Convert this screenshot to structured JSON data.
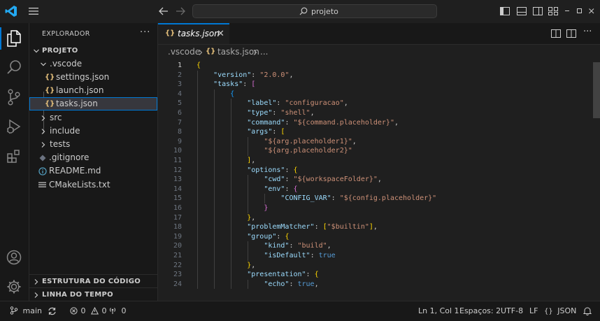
{
  "titlebar": {
    "search_text": "projeto"
  },
  "sidebar": {
    "title": "EXPLORADOR",
    "more": "···",
    "root": "PROJETO",
    "tree": [
      {
        "label": ".vscode",
        "type": "folder",
        "open": true,
        "depth": 1
      },
      {
        "label": "settings.json",
        "type": "json",
        "depth": 2
      },
      {
        "label": "launch.json",
        "type": "json",
        "depth": 2
      },
      {
        "label": "tasks.json",
        "type": "json",
        "depth": 2,
        "selected": true
      },
      {
        "label": "src",
        "type": "folder",
        "open": false,
        "depth": 1
      },
      {
        "label": "include",
        "type": "folder",
        "open": false,
        "depth": 1
      },
      {
        "label": "tests",
        "type": "folder",
        "open": false,
        "depth": 1
      },
      {
        "label": ".gitignore",
        "type": "gitignore",
        "depth": 1
      },
      {
        "label": "README.md",
        "type": "info",
        "depth": 1
      },
      {
        "label": "CMakeLists.txt",
        "type": "lines",
        "depth": 1
      }
    ],
    "outline": "ESTRUTURA DO CÓDIGO",
    "timeline": "LINHA DO TEMPO"
  },
  "editor": {
    "tab_label": "tasks.json",
    "tab_icon": "{}",
    "breadcrumb": [
      ".vscode",
      "tasks.json",
      "..."
    ],
    "current_line": 1
  },
  "code_lines": [
    [
      [
        "p1",
        "{"
      ]
    ],
    [
      [
        "i",
        "    "
      ],
      [
        "k",
        "\"version\""
      ],
      [
        "t",
        ": "
      ],
      [
        "s",
        "\"2.0.0\""
      ],
      [
        "t",
        ","
      ]
    ],
    [
      [
        "i",
        "    "
      ],
      [
        "k",
        "\"tasks\""
      ],
      [
        "t",
        ": "
      ],
      [
        "p2",
        "["
      ]
    ],
    [
      [
        "i",
        "        "
      ],
      [
        "p3",
        "{"
      ]
    ],
    [
      [
        "i",
        "            "
      ],
      [
        "k",
        "\"label\""
      ],
      [
        "t",
        ": "
      ],
      [
        "s",
        "\"configuracao\""
      ],
      [
        "t",
        ","
      ]
    ],
    [
      [
        "i",
        "            "
      ],
      [
        "k",
        "\"type\""
      ],
      [
        "t",
        ": "
      ],
      [
        "s",
        "\"shell\""
      ],
      [
        "t",
        ","
      ]
    ],
    [
      [
        "i",
        "            "
      ],
      [
        "k",
        "\"command\""
      ],
      [
        "t",
        ": "
      ],
      [
        "s",
        "\"${command.placeholder}\""
      ],
      [
        "t",
        ","
      ]
    ],
    [
      [
        "i",
        "            "
      ],
      [
        "k",
        "\"args\""
      ],
      [
        "t",
        ": "
      ],
      [
        "p1",
        "["
      ]
    ],
    [
      [
        "i",
        "                "
      ],
      [
        "s",
        "\"${arg.placeholder1}\""
      ],
      [
        "t",
        ","
      ]
    ],
    [
      [
        "i",
        "                "
      ],
      [
        "s",
        "\"${arg.placeholder2}\""
      ]
    ],
    [
      [
        "i",
        "            "
      ],
      [
        "p1",
        "]"
      ],
      [
        "t",
        ","
      ]
    ],
    [
      [
        "i",
        "            "
      ],
      [
        "k",
        "\"options\""
      ],
      [
        "t",
        ": "
      ],
      [
        "p1",
        "{"
      ]
    ],
    [
      [
        "i",
        "                "
      ],
      [
        "k",
        "\"cwd\""
      ],
      [
        "t",
        ": "
      ],
      [
        "s",
        "\"${workspaceFolder}\""
      ],
      [
        "t",
        ","
      ]
    ],
    [
      [
        "i",
        "                "
      ],
      [
        "k",
        "\"env\""
      ],
      [
        "t",
        ": "
      ],
      [
        "p2",
        "{"
      ]
    ],
    [
      [
        "i",
        "                    "
      ],
      [
        "k",
        "\"CONFIG_VAR\""
      ],
      [
        "t",
        ": "
      ],
      [
        "s",
        "\"${config.placeholder}\""
      ]
    ],
    [
      [
        "i",
        "                "
      ],
      [
        "p2",
        "}"
      ]
    ],
    [
      [
        "i",
        "            "
      ],
      [
        "p1",
        "}"
      ],
      [
        "t",
        ","
      ]
    ],
    [
      [
        "i",
        "            "
      ],
      [
        "k",
        "\"problemMatcher\""
      ],
      [
        "t",
        ": "
      ],
      [
        "p1",
        "["
      ],
      [
        "s",
        "\"$builtin\""
      ],
      [
        "p1",
        "]"
      ],
      [
        "t",
        ","
      ]
    ],
    [
      [
        "i",
        "            "
      ],
      [
        "k",
        "\"group\""
      ],
      [
        "t",
        ": "
      ],
      [
        "p1",
        "{"
      ]
    ],
    [
      [
        "i",
        "                "
      ],
      [
        "k",
        "\"kind\""
      ],
      [
        "t",
        ": "
      ],
      [
        "s",
        "\"build\""
      ],
      [
        "t",
        ","
      ]
    ],
    [
      [
        "i",
        "                "
      ],
      [
        "k",
        "\"isDefault\""
      ],
      [
        "t",
        ": "
      ],
      [
        "b",
        "true"
      ]
    ],
    [
      [
        "i",
        "            "
      ],
      [
        "p1",
        "}"
      ],
      [
        "t",
        ","
      ]
    ],
    [
      [
        "i",
        "            "
      ],
      [
        "k",
        "\"presentation\""
      ],
      [
        "t",
        ": "
      ],
      [
        "p1",
        "{"
      ]
    ],
    [
      [
        "i",
        "                "
      ],
      [
        "k",
        "\"echo\""
      ],
      [
        "t",
        ": "
      ],
      [
        "b",
        "true"
      ],
      [
        "t",
        ","
      ]
    ]
  ],
  "statusbar": {
    "branch": "main",
    "errors": "0",
    "warnings": "0",
    "ports": "0",
    "position": "Ln 1, Col 1",
    "indent": "Espaços: 2",
    "encoding": "UTF-8",
    "eol": "LF",
    "language": "JSON",
    "language_icon": "{}"
  },
  "colors": {
    "accent": "#0078d4",
    "logo": "#23a9f2",
    "json_icon": "#e5c07b"
  }
}
